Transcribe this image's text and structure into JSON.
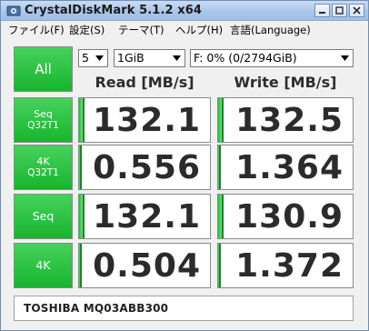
{
  "window": {
    "title": "CrystalDiskMark 5.1.2 x64"
  },
  "menu": [
    "ファイル(F)",
    "設定(S)",
    "テーマ(T)",
    "ヘルプ(H)",
    "言語(Language)"
  ],
  "controls": {
    "all_label": "All",
    "count": "5",
    "size": "1GiB",
    "drive": "F: 0% (0/2794GiB)"
  },
  "columns": {
    "read": "Read [MB/s]",
    "write": "Write [MB/s]"
  },
  "rows": [
    {
      "line1": "Seq",
      "line2": "Q32T1",
      "read": "132.1",
      "write": "132.5",
      "read_fill": 0.04,
      "write_fill": 0.04
    },
    {
      "line1": "4K",
      "line2": "Q32T1",
      "read": "0.556",
      "write": "1.364",
      "read_fill": 0.02,
      "write_fill": 0.02
    },
    {
      "line1": "Seq",
      "line2": "",
      "read": "132.1",
      "write": "130.9",
      "read_fill": 0.04,
      "write_fill": 0.04
    },
    {
      "line1": "4K",
      "line2": "",
      "read": "0.504",
      "write": "1.372",
      "read_fill": 0.02,
      "write_fill": 0.02
    }
  ],
  "comment": "TOSHIBA MQ03ABB300",
  "colors": {
    "accent_green": "#17b52e",
    "bar_green": "#22bf3a"
  }
}
